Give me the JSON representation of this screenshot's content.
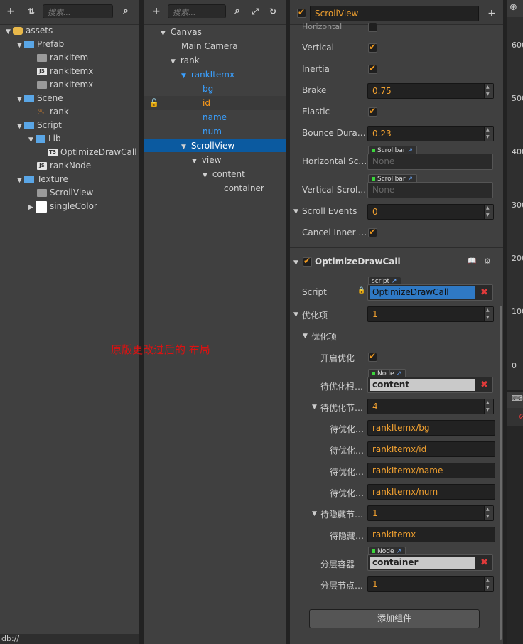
{
  "assets": {
    "search_placeholder": "搜索...",
    "tree": [
      {
        "label": "assets",
        "icon": "asset-root-icon"
      },
      {
        "label": "Prefab",
        "icon": "folder-icon"
      },
      {
        "label": "rankItem",
        "icon": "prefab-icon"
      },
      {
        "label": "rankItemx",
        "icon": "js-icon"
      },
      {
        "label": "rankItemx",
        "icon": "prefab-icon"
      },
      {
        "label": "Scene",
        "icon": "folder-icon"
      },
      {
        "label": "rank",
        "icon": "scene-icon"
      },
      {
        "label": "Script",
        "icon": "folder-icon"
      },
      {
        "label": "Lib",
        "icon": "folder-icon"
      },
      {
        "label": "OptimizeDrawCall",
        "icon": "ts-icon"
      },
      {
        "label": "rankNode",
        "icon": "js-icon"
      },
      {
        "label": "Texture",
        "icon": "folder-icon"
      },
      {
        "label": "ScrollView",
        "icon": "prefab-icon"
      },
      {
        "label": "singleColor",
        "icon": "texture-icon"
      }
    ],
    "status": "db://"
  },
  "hierarchy": {
    "search_placeholder": "搜索...",
    "nodes": [
      {
        "label": "Canvas"
      },
      {
        "label": "Main Camera"
      },
      {
        "label": "rank"
      },
      {
        "label": "rankItemx"
      },
      {
        "label": "bg"
      },
      {
        "label": "id"
      },
      {
        "label": "name"
      },
      {
        "label": "num"
      },
      {
        "label": "ScrollView"
      },
      {
        "label": "view"
      },
      {
        "label": "content"
      },
      {
        "label": "container"
      }
    ],
    "annotation": "原版更改过后的 布局"
  },
  "inspector": {
    "node_name": "ScrollView",
    "props": {
      "horizontal": "Horizontal",
      "vertical": "Vertical",
      "inertia": "Inertia",
      "brake": "Brake",
      "brake_value": "0.75",
      "elastic": "Elastic",
      "bounce": "Bounce Dura…",
      "bounce_value": "0.23",
      "hscroll": "Horizontal Sc…",
      "vscroll": "Vertical Scrol…",
      "scrollbar_tag": "Scrollbar",
      "none": "None",
      "scroll_events": "Scroll Events",
      "scroll_events_value": "0",
      "cancel_inner": "Cancel Inner …"
    },
    "component": {
      "title": "OptimizeDrawCall",
      "script_label": "Script",
      "script_tag": "script",
      "script_value": "OptimizeDrawCall",
      "opt_items": "优化项",
      "opt_items_value": "1",
      "opt_sub": "优化项",
      "enable_opt": "开启优化",
      "root_label": "待优化根…",
      "node_tag": "Node",
      "root_value": "content",
      "nodes_label": "待优化节…",
      "nodes_value": "4",
      "item_label": "待优化…",
      "items": [
        "rankItemx/bg",
        "rankItemx/id",
        "rankItemx/name",
        "rankItemx/num"
      ],
      "hide_label": "待隐藏节…",
      "hide_value": "1",
      "hide_item_label": "待隐藏…",
      "hide_item": "rankItemx",
      "layer_container": "分层容器",
      "layer_container_value": "container",
      "layer_nodes": "分层节点…",
      "layer_nodes_value": "1"
    },
    "add_component": "添加组件"
  },
  "scene": {
    "ticks": [
      "600",
      "500",
      "400",
      "300",
      "200",
      "100",
      "0"
    ]
  }
}
